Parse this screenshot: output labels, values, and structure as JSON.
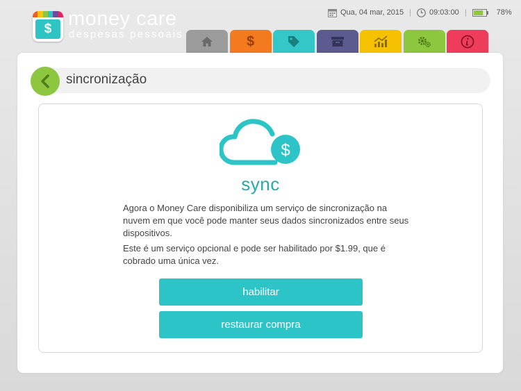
{
  "header": {
    "app_title": "money care",
    "app_subtitle": "despesas pessoais",
    "logo_symbol": "$",
    "logo_stripe_colors": [
      "#f15a29",
      "#ffc20e",
      "#8dc63f",
      "#2fc4c4",
      "#6d4c9f",
      "#e0245e"
    ]
  },
  "status": {
    "date": "Qua, 04 mar, 2015",
    "time": "09:03:00",
    "battery": "78%",
    "battery_level": 0.78
  },
  "tabs": [
    {
      "name": "home",
      "icon": "home-icon",
      "color": "#9b9b9b"
    },
    {
      "name": "expenses",
      "icon": "dollar-icon",
      "color": "#f47a20"
    },
    {
      "name": "categories",
      "icon": "tag-icon",
      "color": "#33c7c7"
    },
    {
      "name": "archive",
      "icon": "archive-icon",
      "color": "#5b5b8f"
    },
    {
      "name": "reports",
      "icon": "chart-icon",
      "color": "#f6c200"
    },
    {
      "name": "settings",
      "icon": "gears-icon",
      "color": "#8dc63f",
      "active": true
    },
    {
      "name": "info",
      "icon": "info-icon",
      "color": "#ee3d5a"
    }
  ],
  "section": {
    "title": "sincronização"
  },
  "sync": {
    "title": "sync",
    "cloud_symbol": "$",
    "description_1": "Agora o Money Care disponibiliza um serviço de sincronização na nuvem em que você pode manter seus dados sincronizados entre seus dispositivos.",
    "description_2": "Este é um serviço opcional e pode ser habilitado por $1.99, que é cobrado uma única vez.",
    "enable_label": "habilitar",
    "restore_label": "restaurar compra"
  },
  "colors": {
    "accent": "#2cc4c6",
    "back_button": "#8dc63f"
  }
}
